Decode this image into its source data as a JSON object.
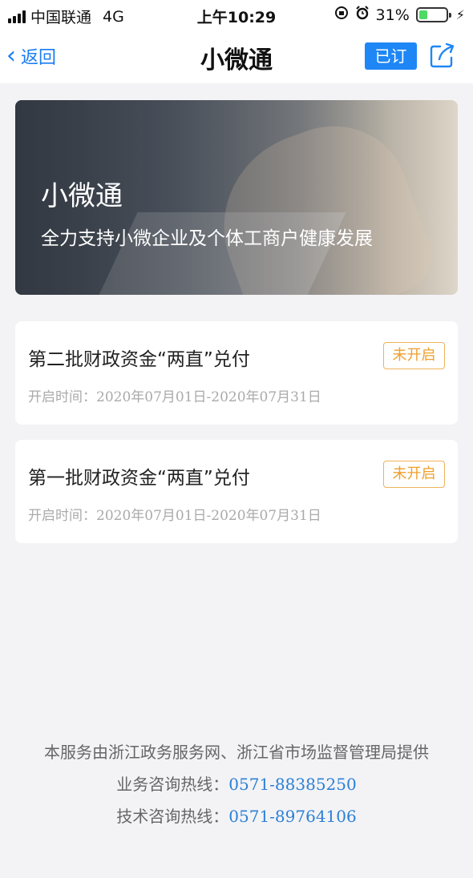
{
  "status_bar": {
    "carrier": "中国联通",
    "network": "4G",
    "time": "上午10:29",
    "battery": "31%",
    "battery_level": 0.31
  },
  "nav": {
    "back_label": "返回",
    "title": "小微通",
    "subscribed_label": "已订"
  },
  "banner": {
    "title": "小微通",
    "subtitle": "全力支持小微企业及个体工商户健康发展"
  },
  "items": [
    {
      "title": "第二批财政资金“两直”兑付",
      "time": "开启时间：2020年07月01日-2020年07月31日",
      "status": "未开启"
    },
    {
      "title": "第一批财政资金“两直”兑付",
      "time": "开启时间：2020年07月01日-2020年07月31日",
      "status": "未开启"
    }
  ],
  "footer": {
    "provider": "本服务由浙江政务服务网、浙江省市场监督管理局提供",
    "business_label": "业务咨询热线：",
    "business_phone": "0571-88385250",
    "tech_label": "技术咨询热线：",
    "tech_phone": "0571-89764106"
  },
  "colors": {
    "accent": "#1f87f5",
    "badge": "#ef9f2b",
    "link": "#2b80d6",
    "background": "#f3f3f6"
  }
}
